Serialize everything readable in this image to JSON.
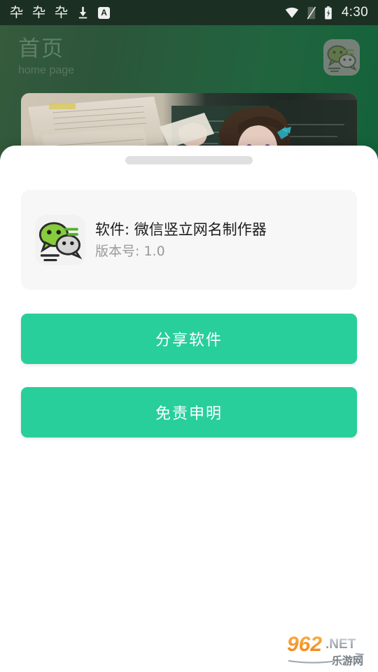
{
  "statusbar": {
    "icons_left": [
      {
        "name": "app-notification-icon-1",
        "glyph": "卆"
      },
      {
        "name": "app-notification-icon-2",
        "glyph": "卆"
      },
      {
        "name": "app-notification-icon-3",
        "glyph": "卆"
      },
      {
        "name": "download-icon",
        "glyph": "download"
      },
      {
        "name": "input-method-a-icon",
        "glyph": "A"
      }
    ],
    "wifi_icon": "wifi-icon",
    "sim_icon": "no-sim-icon",
    "battery_icon": "battery-charging-icon",
    "time": "4:30"
  },
  "header": {
    "title": "首页",
    "subtitle": "home page",
    "app_icon": "wechat-icon"
  },
  "sheet": {
    "handle": "drag-handle",
    "info_card": {
      "app_icon": "wechat-icon",
      "software_line": "软件: 微信竖立网名制作器",
      "version_line": "版本号: 1.0"
    },
    "buttons": [
      {
        "name": "share-software-button",
        "label": "分享软件"
      },
      {
        "name": "disclaimer-button",
        "label": "免责申明"
      }
    ]
  },
  "watermark": {
    "number": "962",
    "domain": ".NET",
    "chinese": "乐游网"
  },
  "colors": {
    "accent_green": "#28cf9a",
    "header_green_left": "#3a6141",
    "header_green_right": "#14683e",
    "statusbar_bg": "#1d3426",
    "card_bg": "#f7f7f7",
    "sheet_bg": "#ffffff",
    "watermark_orange": "#f08a1c"
  }
}
